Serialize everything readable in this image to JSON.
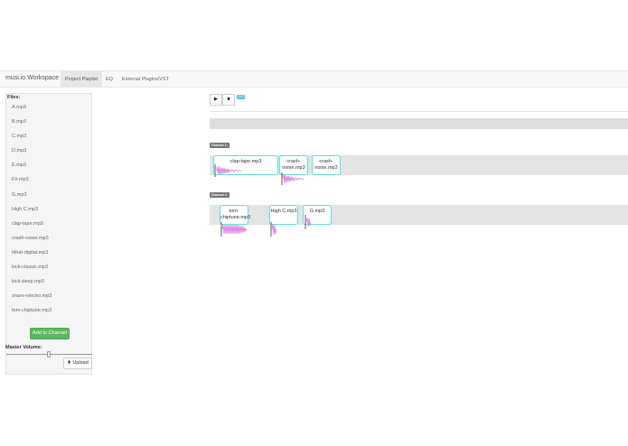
{
  "navbar": {
    "brand": "musi.io Workspace",
    "tabs": [
      "Project Playlist",
      "EQ",
      "External Plugins/VST"
    ]
  },
  "sidebar": {
    "files_label": "Files:",
    "files": [
      "A.mp3",
      "B.mp3",
      "C.mp3",
      "D.mp3",
      "E.mp3",
      "F#.mp3",
      "G.mp3",
      "High C.mp3",
      "clap-tape.mp3",
      "crash-noise.mp3",
      "hihat-digital.mp3",
      "kick-classic.mp3",
      "kick-deep.mp3",
      "snare-electro.mp3",
      "tom-chiptune.mp3"
    ],
    "add_button": "Add to Channel",
    "master_volume_label": "Master Volume:",
    "upload_button": "Upload",
    "master_volume_value": 0.5
  },
  "transport": {
    "play_icon": "▶",
    "stop_icon": "■",
    "badge": "120"
  },
  "channels": [
    {
      "label": "Channel 1:",
      "clips": [
        "clap-tape.mp3",
        "crash-noise.mp3",
        "crash-noise.mp3"
      ]
    },
    {
      "label": "Channel 2:",
      "clips": [
        "tom-chiptune.mp3",
        "High C.mp3",
        "G.mp3"
      ]
    }
  ],
  "colors": {
    "clip_border": "#5ee0e0",
    "waveform": "#e070e0",
    "add_button": "#5cb85c",
    "badge": "#5bc0de"
  }
}
